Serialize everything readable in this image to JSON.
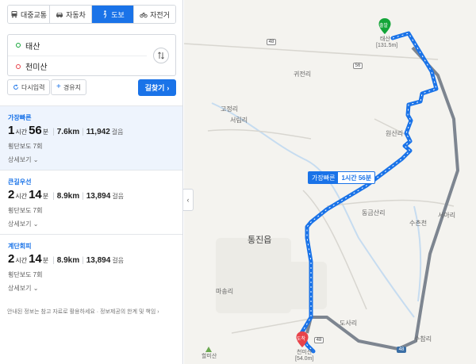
{
  "mode_tabs": [
    {
      "label": "대중교통",
      "icon": "bus-icon"
    },
    {
      "label": "자동차",
      "icon": "car-icon"
    },
    {
      "label": "도보",
      "icon": "walk-icon",
      "active": true
    },
    {
      "label": "자전거",
      "icon": "bicycle-icon"
    }
  ],
  "route": {
    "origin": "태산",
    "destination": "천미산",
    "swap_icon": "swap-icon"
  },
  "options": {
    "reset_label": "다시입력",
    "waypoint_label": "경유지",
    "search_label": "길찾기"
  },
  "results": [
    {
      "label": "가장빠른",
      "hours": "1",
      "hours_unit": "시간",
      "minutes": "56",
      "minutes_unit": "분",
      "distance": "7.6km",
      "steps": "11,942",
      "steps_unit": "걸음",
      "crosswalk": "횡단보도 7회",
      "detail": "상세보기"
    },
    {
      "label": "큰길우선",
      "hours": "2",
      "hours_unit": "시간",
      "minutes": "14",
      "minutes_unit": "분",
      "distance": "8.9km",
      "steps": "13,894",
      "steps_unit": "걸음",
      "crosswalk": "횡단보도 7회",
      "detail": "상세보기"
    },
    {
      "label": "계단회피",
      "hours": "2",
      "hours_unit": "시간",
      "minutes": "14",
      "minutes_unit": "분",
      "distance": "8.9km",
      "steps": "13,894",
      "steps_unit": "걸음",
      "crosswalk": "횡단보도 7회",
      "detail": "상세보기"
    }
  ],
  "footer_note": "안내된 정보는 참고 자료로 활용하세요 · 정보제공의 한계 및 책임",
  "map": {
    "places": [
      "귀전리",
      "고정리",
      "서림리",
      "원산리",
      "동금산리",
      "수촌천",
      "서아리",
      "통진읍",
      "마송리",
      "도사리",
      "수참리"
    ],
    "time_bubble": {
      "label": "가장빠른",
      "time": "1시간 56분"
    },
    "start_pin": {
      "tag": "출발",
      "name": "태산",
      "elevation": "[131.5m]"
    },
    "end_pin": {
      "tag": "도착",
      "name": "천미산",
      "elevation": "[54.0m]"
    },
    "other_peak": {
      "name": "할미산"
    },
    "road_badges": [
      "48",
      "56",
      "48",
      "48"
    ],
    "colors": {
      "route": "#1a73e8",
      "road": "#7d8590",
      "start": "#13a538",
      "end": "#e8434a",
      "water": "#c6dcf0"
    }
  }
}
